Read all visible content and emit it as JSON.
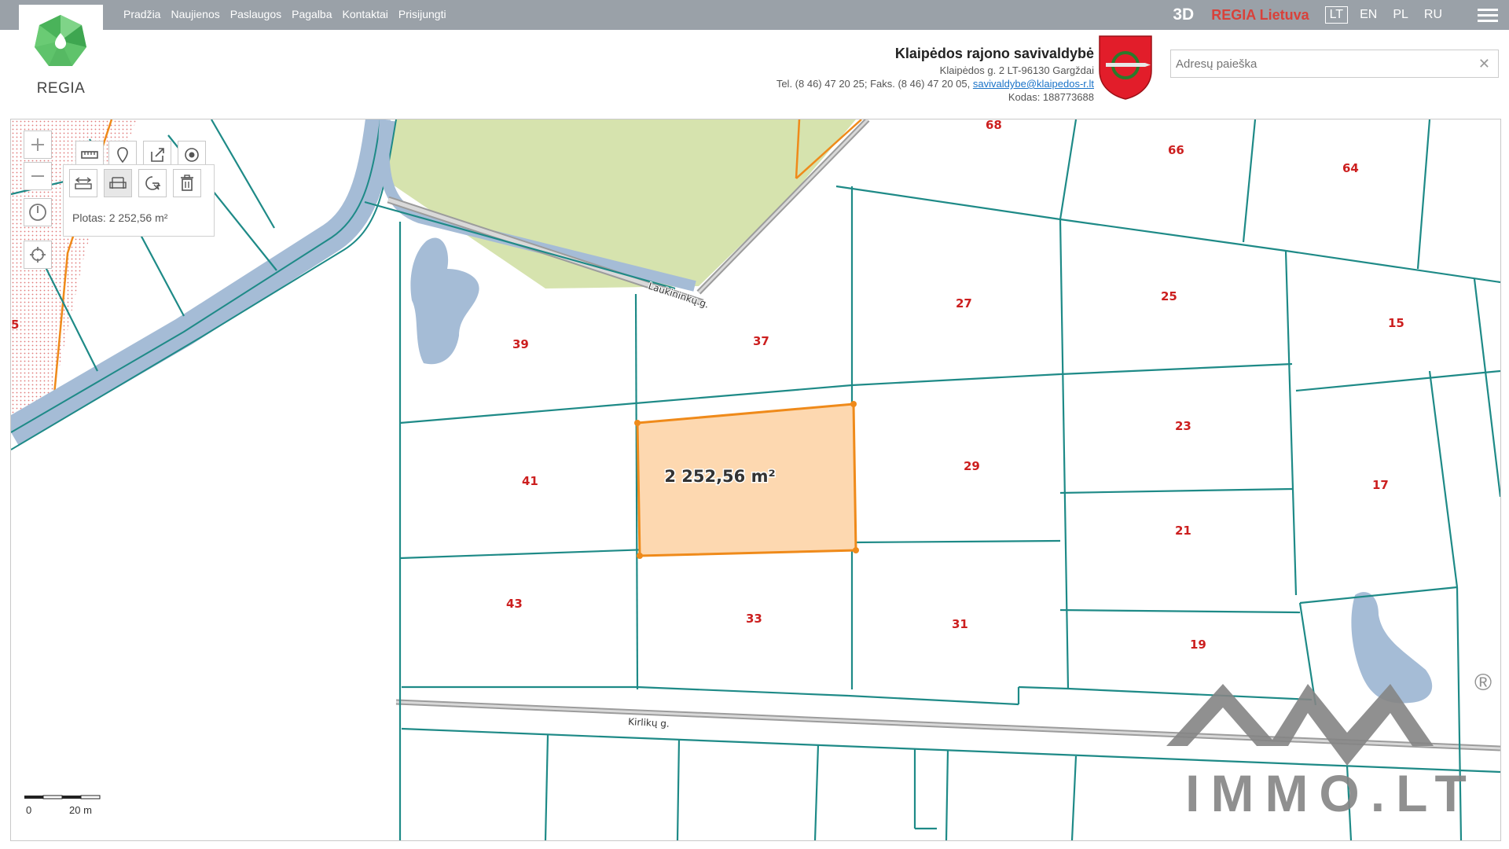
{
  "nav": {
    "logo_text": "REGIA",
    "links": [
      "Pradžia",
      "Naujienos",
      "Paslaugos",
      "Pagalba",
      "Kontaktai",
      "Prisijungti"
    ]
  },
  "top_right": {
    "btn_3d": "3D",
    "regia_lietuva": "REGIA Lietuva",
    "languages": [
      "LT",
      "EN",
      "PL",
      "RU"
    ],
    "active_language": "LT"
  },
  "municipality": {
    "name": "Klaipėdos rajono savivaldybė",
    "address": "Klaipėdos g. 2 LT-96130 Gargždai",
    "phone": "Tel. (8 46) 47 20 25; Faks. (8 46) 47 20 05,",
    "email": "savivaldybe@klaipedos-r.lt",
    "code": "Kodas: 188773688"
  },
  "search": {
    "placeholder": "Adresų paieška",
    "value": ""
  },
  "measure_panel": {
    "area_text": "Plotas: 2 252,56 m²"
  },
  "map": {
    "selected_area": "2 252,56 m²",
    "streets": [
      "Laukininkų g.",
      "Kirlikų g."
    ],
    "lots": [
      "68",
      "66",
      "64",
      "39",
      "37",
      "27",
      "25",
      "15",
      "41",
      "29",
      "23",
      "17",
      "21",
      "43",
      "33",
      "31",
      "19",
      "5"
    ],
    "scale": {
      "zero": "0",
      "distance": "20 m"
    },
    "watermark": "IMMO.LT",
    "watermark_mark": "®",
    "colors": {
      "parcel_line": "#1e8a87",
      "selection_fill": "#fdd8b0",
      "selection_stroke": "#ef8a1a",
      "water": "#a5bcd6",
      "forest": "#d6e3ae",
      "lot_label": "#cc1f1f"
    }
  }
}
